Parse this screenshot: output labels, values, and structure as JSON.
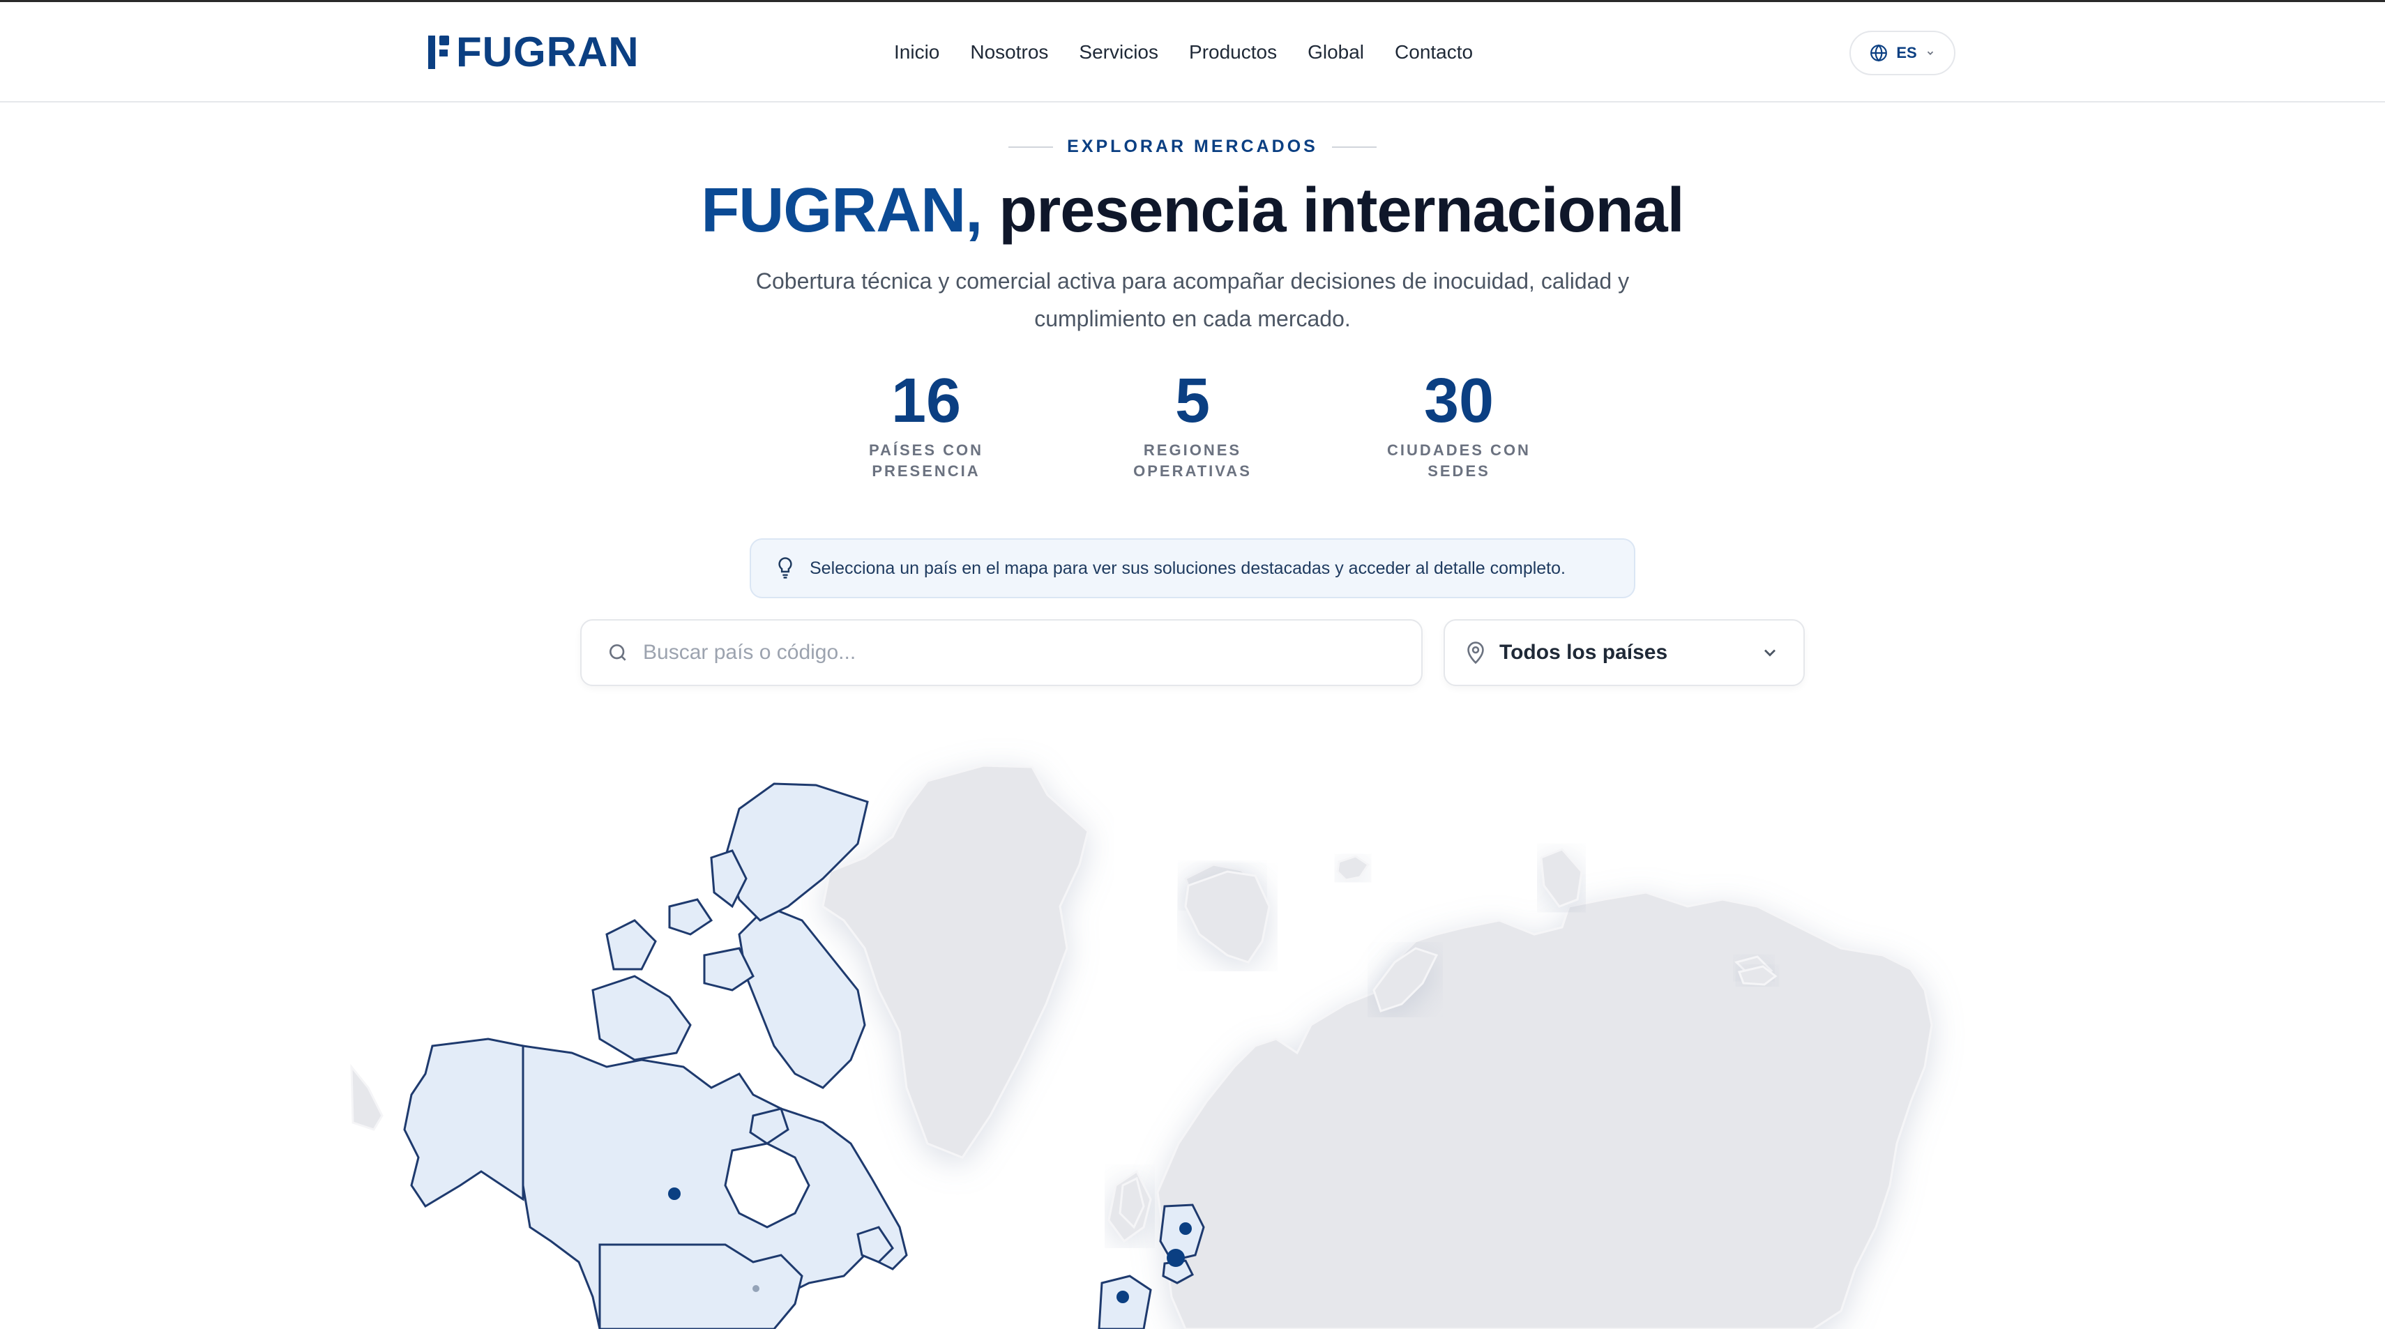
{
  "header": {
    "logo_text": "FUGRAN",
    "nav": [
      "Inicio",
      "Nosotros",
      "Servicios",
      "Productos",
      "Global",
      "Contacto"
    ],
    "language": {
      "code": "ES",
      "icon": "globe-icon"
    }
  },
  "hero": {
    "eyebrow": "EXPLORAR MERCADOS",
    "title_brand": "FUGRAN,",
    "title_rest": " presencia internacional",
    "subtitle": "Cobertura técnica y comercial activa para acompañar decisiones de inocuidad, calidad y cumplimiento en cada mercado."
  },
  "stats": [
    {
      "value": "16",
      "label_line1": "PAÍSES CON",
      "label_line2": "PRESENCIA"
    },
    {
      "value": "5",
      "label_line1": "REGIONES",
      "label_line2": "OPERATIVAS"
    },
    {
      "value": "30",
      "label_line1": "CIUDADES CON",
      "label_line2": "SEDES"
    }
  ],
  "hint": {
    "icon": "lightbulb-icon",
    "text": "Selecciona un país en el mapa para ver sus soluciones destacadas y acceder al detalle completo."
  },
  "search": {
    "icon": "search-icon",
    "placeholder": "Buscar país o código...",
    "value": ""
  },
  "country_select": {
    "icon": "map-pin-icon",
    "selected": "Todos los países"
  },
  "colors": {
    "brand": "#0b3f82",
    "land": "#e5e7eb",
    "highlight": "#e3ecf8",
    "border": "#1e3a6e"
  }
}
